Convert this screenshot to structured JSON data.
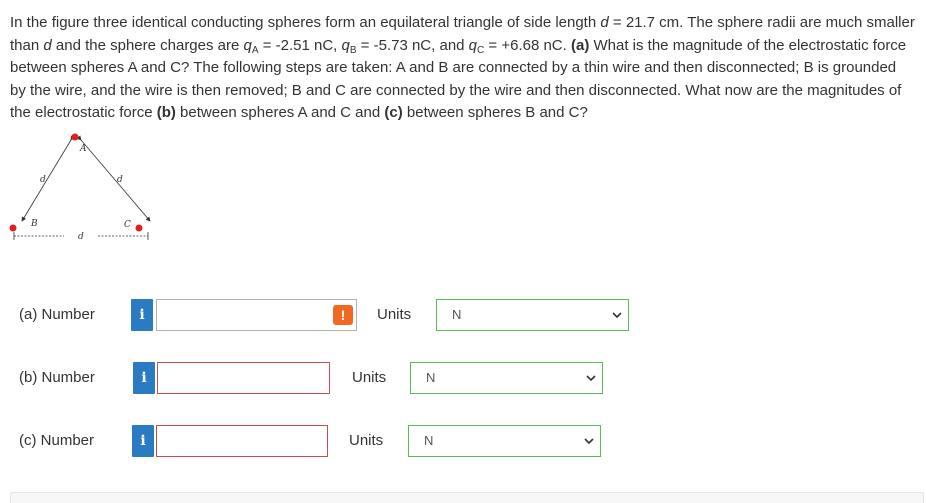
{
  "problem": {
    "p1": "In the figure three identical conducting spheres form an equilateral triangle of side length ",
    "d_var": "d",
    "p2": " = 21.7 cm. The sphere radii are much smaller than ",
    "d_var2": "d",
    "p3": " and the sphere charges are ",
    "qA_var": "q",
    "qA_sub": "A",
    "qA_val": " = -2.51 nC, ",
    "qB_var": "q",
    "qB_sub": "B",
    "qB_val": " = -5.73 nC, and ",
    "qC_var": "q",
    "qC_sub": "C",
    "qC_val": " = +6.68 nC. ",
    "part_a_tag": "(a)",
    "p4": " What is the magnitude of the electrostatic force between spheres A and C? The following steps are taken: A and B are connected by a thin wire and then disconnected; B is grounded by the wire, and the wire is then removed; B and C are connected by the wire and then disconnected. What now are the magnitudes of the electrostatic force ",
    "part_b_tag": "(b)",
    "p5": " between spheres A and C and ",
    "part_c_tag": "(c)",
    "p6": " between spheres B and C?"
  },
  "figure": {
    "label_A": "A",
    "label_B": "B",
    "label_C": "C",
    "label_d_left": "d",
    "label_d_right": "d",
    "label_d_bottom": "d",
    "sphere_color": "#e02020"
  },
  "answers": [
    {
      "label": "(a)  Number",
      "info": "i",
      "value": "",
      "alert": "!",
      "units_label": "Units",
      "units_value": "N"
    },
    {
      "label": "(b)  Number",
      "info": "i",
      "value": "",
      "units_label": "Units",
      "units_value": "N"
    },
    {
      "label": "(c)  Number",
      "info": "i",
      "value": "",
      "units_label": "Units",
      "units_value": "N"
    }
  ],
  "colors": {
    "info_button": "#2a7ac4",
    "alert": "#f26722",
    "error_border": "#c0504d",
    "select_border": "#5cb85c"
  }
}
